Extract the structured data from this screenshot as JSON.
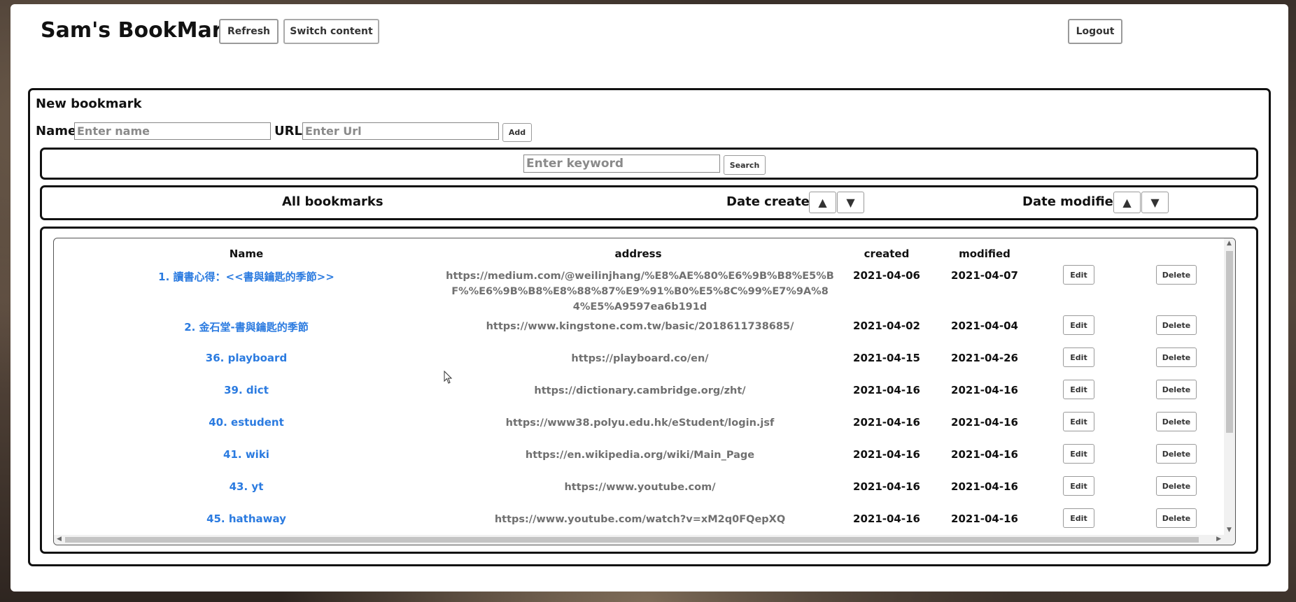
{
  "app_title": "Sam's BookMark",
  "header": {
    "refresh_label": "Refresh",
    "switch_label": "Switch content",
    "logout_label": "Logout"
  },
  "new_bookmark": {
    "title": "New bookmark",
    "name_label": "Name",
    "name_placeholder": "Enter name",
    "url_label": "URL",
    "url_placeholder": "Enter Url",
    "add_label": "Add"
  },
  "search": {
    "placeholder": "Enter keyword",
    "button_label": "Search"
  },
  "sort_bar": {
    "all_label": "All bookmarks",
    "created_label": "Date created",
    "modified_label": "Date modified",
    "up_glyph": "▲",
    "down_glyph": "▼"
  },
  "table": {
    "headers": {
      "name": "Name",
      "address": "address",
      "created": "created",
      "modified": "modified"
    },
    "edit_label": "Edit",
    "delete_label": "Delete",
    "rows": [
      {
        "name": "1. 讀書心得：<<書與鑰匙的季節>>",
        "address": "https://medium.com/@weilinjhang/%E8%AE%80%E6%9B%B8%E5%BF%%E6%9B%B8%E8%88%87%E9%91%B0%E5%8C%99%E7%9A%84%E5%A9597ea6b191d",
        "created": "2021-04-06",
        "modified": "2021-04-07"
      },
      {
        "name": "2. 金石堂-書與鑰匙的季節",
        "address": "https://www.kingstone.com.tw/basic/2018611738685/",
        "created": "2021-04-02",
        "modified": "2021-04-04"
      },
      {
        "name": "36. playboard",
        "address": "https://playboard.co/en/",
        "created": "2021-04-15",
        "modified": "2021-04-26"
      },
      {
        "name": "39. dict",
        "address": "https://dictionary.cambridge.org/zht/",
        "created": "2021-04-16",
        "modified": "2021-04-16"
      },
      {
        "name": "40. estudent",
        "address": "https://www38.polyu.edu.hk/eStudent/login.jsf",
        "created": "2021-04-16",
        "modified": "2021-04-16"
      },
      {
        "name": "41. wiki",
        "address": "https://en.wikipedia.org/wiki/Main_Page",
        "created": "2021-04-16",
        "modified": "2021-04-16"
      },
      {
        "name": "43. yt",
        "address": "https://www.youtube.com/",
        "created": "2021-04-16",
        "modified": "2021-04-16"
      },
      {
        "name": "45. hathaway",
        "address": "https://www.youtube.com/watch?v=xM2q0FQepXQ",
        "created": "2021-04-16",
        "modified": "2021-04-16"
      }
    ]
  }
}
